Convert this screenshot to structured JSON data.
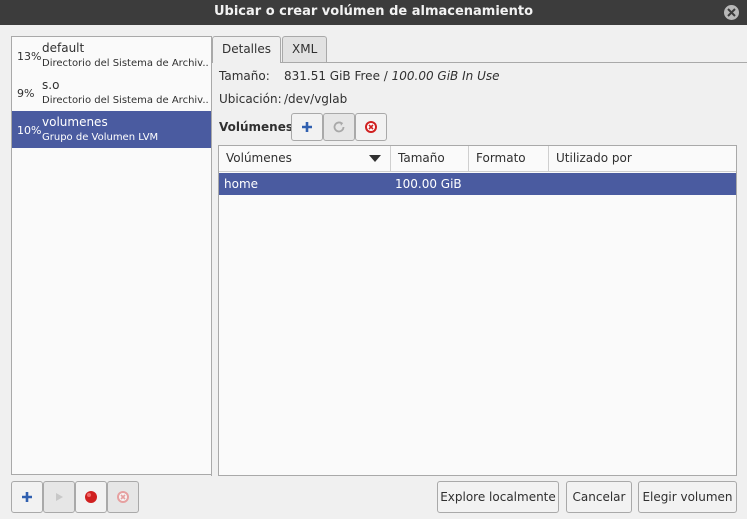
{
  "window": {
    "title": "Ubicar o crear volúmen de almacenamiento"
  },
  "pools": [
    {
      "percent": "13%",
      "name": "default",
      "type": "Directorio del Sistema de Archiv..."
    },
    {
      "percent": "9%",
      "name": "s.o",
      "type": "Directorio del Sistema de Archiv..."
    },
    {
      "percent": "10%",
      "name": "volumenes",
      "type": "Grupo de Volumen LVM"
    }
  ],
  "tabs": {
    "details": "Detalles",
    "xml": "XML"
  },
  "details": {
    "size_label": "Tamaño:",
    "size_free": "831.51 GiB Free",
    "size_sep": " / ",
    "size_in_use": "100.00 GiB In Use",
    "location_label": "Ubicación:",
    "location_value": "/dev/vglab",
    "volumes_label": "Volúmenes"
  },
  "volumes_table": {
    "columns": [
      "Volúmenes",
      "Tamaño",
      "Formato",
      "Utilizado por"
    ],
    "rows": [
      {
        "name": "home",
        "size": "100.00 GiB",
        "format": "",
        "used_by": ""
      }
    ]
  },
  "footer": {
    "explore": "Explore localmente",
    "cancel": "Cancelar",
    "choose": "Elegir volumen"
  },
  "colors": {
    "selection": "#4a5ba0",
    "titlebar": "#3c3c3c",
    "delete_red": "#d02020",
    "add_blue": "#3060b0"
  }
}
